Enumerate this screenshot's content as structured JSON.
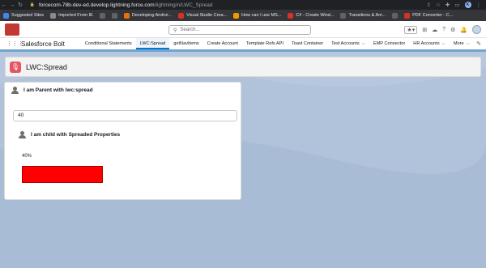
{
  "browser": {
    "url_host": "forcecom-78b-dev-ed.develop.lightning.force.com",
    "url_path": "/lightning/n/LWC_Spread",
    "profile_initial": "K",
    "bookmarks": [
      {
        "label": "Suggested Sites",
        "color": "#4285f4"
      },
      {
        "label": "Imported From IE",
        "color": "#8a8a8a"
      },
      {
        "label": "",
        "color": "#5f6368"
      },
      {
        "label": "",
        "color": "#5f6368"
      },
      {
        "label": "Developing Androi...",
        "color": "#e8710a"
      },
      {
        "label": "Visual Studio Crea...",
        "color": "#d93025"
      },
      {
        "label": "How can I use MS...",
        "color": "#f29900"
      },
      {
        "label": "C# - Create Wind...",
        "color": "#d93025"
      },
      {
        "label": "Transitions & Ani...",
        "color": "#5f6368"
      },
      {
        "label": "",
        "color": "#5f6368"
      },
      {
        "label": "PDF Converter - C...",
        "color": "#d93025"
      }
    ]
  },
  "header": {
    "search_placeholder": "Search..."
  },
  "nav": {
    "app_name": "Salesforce Bolt",
    "items": [
      {
        "label": "Conditional Statements",
        "active": false,
        "dropdown": false
      },
      {
        "label": "LWC:Spread",
        "active": true,
        "dropdown": false
      },
      {
        "label": "getNavItems",
        "active": false,
        "dropdown": false
      },
      {
        "label": "Create Account",
        "active": false,
        "dropdown": false
      },
      {
        "label": "Template Refs API",
        "active": false,
        "dropdown": false
      },
      {
        "label": "Toast Container",
        "active": false,
        "dropdown": false
      },
      {
        "label": "Test Accounts",
        "active": false,
        "dropdown": true
      },
      {
        "label": "EMP Connector",
        "active": false,
        "dropdown": false
      },
      {
        "label": "HR Accounts",
        "active": false,
        "dropdown": true
      },
      {
        "label": "More",
        "active": false,
        "dropdown": true
      }
    ]
  },
  "page": {
    "title": "LWC:Spread"
  },
  "parent_card": {
    "title": "I am Parent with lwc:spread",
    "input_value": "40",
    "child": {
      "title": "I am child with Spreaded Properties",
      "percent_label": "40%",
      "bar_color": "#ff0000"
    }
  }
}
